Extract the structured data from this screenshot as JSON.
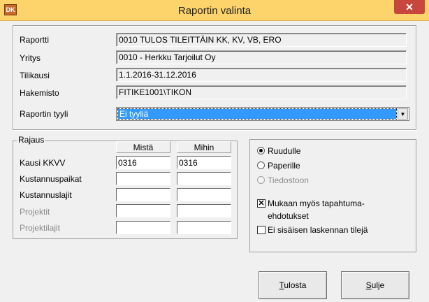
{
  "window": {
    "title": "Raportin valinta",
    "icon_text": "DK",
    "close_glyph": "✕"
  },
  "info": {
    "raportti_label": "Raportti",
    "raportti_value": "0010 TULOS TILEITTÄIN KK, KV, VB, ERO",
    "yritys_label": "Yritys",
    "yritys_value": "0010 - Herkku Tarjoilut Oy",
    "tilikausi_label": "Tilikausi",
    "tilikausi_value": "1.1.2016-31.12.2016",
    "hakemisto_label": "Hakemisto",
    "hakemisto_value": "FITIKE1001\\TIKON",
    "tyyli_label": "Raportin tyyli",
    "tyyli_value": "Ei tyyliä",
    "arrow_glyph": "▼"
  },
  "rajaus": {
    "caption": "Rajaus",
    "col_from": "Mistä",
    "col_to": "Mihin",
    "rows": [
      {
        "label": "Kausi KKVV",
        "from": "0316",
        "to": "0316",
        "enabled": true
      },
      {
        "label": "Kustannuspaikat",
        "from": "",
        "to": "",
        "enabled": true
      },
      {
        "label": "Kustannuslajit",
        "from": "",
        "to": "",
        "enabled": true
      },
      {
        "label": "Projektit",
        "from": "",
        "to": "",
        "enabled": false
      },
      {
        "label": "Projektilajit",
        "from": "",
        "to": "",
        "enabled": false
      }
    ]
  },
  "output": {
    "options": [
      {
        "label": "Ruudulle",
        "checked": true,
        "enabled": true
      },
      {
        "label": "Paperille",
        "checked": false,
        "enabled": true
      },
      {
        "label": "Tiedostoon",
        "checked": false,
        "enabled": false
      }
    ],
    "check_mukaan_line1": "Mukaan myös tapahtuma-",
    "check_mukaan_line2": "ehdotukset",
    "check_mukaan_checked": true,
    "check_mukaan_mark": "✕",
    "check_ei_label": "Ei sisäisen laskennan tilejä",
    "check_ei_checked": false
  },
  "buttons": {
    "print_accel": "T",
    "print_rest": "ulosta",
    "close_accel": "S",
    "close_rest": "ulje"
  }
}
